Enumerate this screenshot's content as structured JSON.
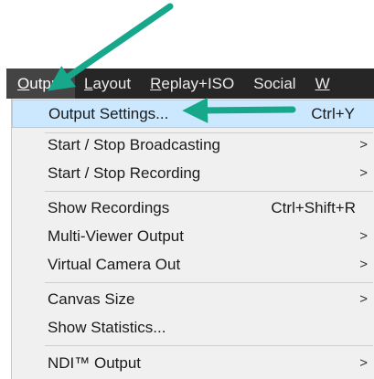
{
  "menubar": {
    "items": [
      {
        "accel": "O",
        "rest": "utput"
      },
      {
        "accel": "L",
        "rest": "ayout"
      },
      {
        "accel": "R",
        "rest": "eplay+ISO"
      },
      {
        "accel": "",
        "rest": "Social"
      },
      {
        "accel": "W",
        "rest": ""
      }
    ]
  },
  "menu": {
    "output_settings": {
      "label": "Output Settings...",
      "shortcut": "Ctrl+Y"
    },
    "start_stop_broadcasting": {
      "label": "Start / Stop Broadcasting",
      "chevron": ">"
    },
    "start_stop_recording": {
      "label": "Start / Stop Recording",
      "chevron": ">"
    },
    "show_recordings": {
      "label": "Show Recordings",
      "shortcut": "Ctrl+Shift+R"
    },
    "multi_viewer_output": {
      "label": "Multi-Viewer Output",
      "chevron": ">"
    },
    "virtual_camera_out": {
      "label": "Virtual Camera Out",
      "chevron": ">"
    },
    "canvas_size": {
      "label": "Canvas Size",
      "chevron": ">"
    },
    "show_statistics": {
      "label": "Show Statistics..."
    },
    "ndi_output": {
      "label": "NDI™ Output",
      "chevron": ">"
    }
  },
  "colors": {
    "annotation_arrow": "#17a78a",
    "menubar_bg": "#262626",
    "menu_bg": "#f0f0f0",
    "highlight": "#cce8ff"
  }
}
